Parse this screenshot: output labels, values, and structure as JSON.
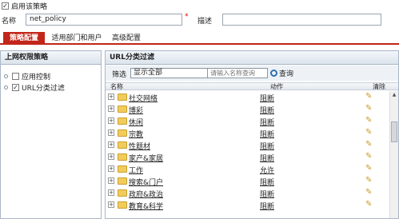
{
  "enable": {
    "label": "启用该策略",
    "checked": "✓"
  },
  "form": {
    "name_label": "名称",
    "name_value": "net_policy",
    "required_mark": "*",
    "desc_label": "描述"
  },
  "tabs": [
    {
      "label": "策略配置"
    },
    {
      "label": "适用部门和用户"
    },
    {
      "label": "高级配置"
    }
  ],
  "left_panel": {
    "title": "上网权限策略",
    "items": [
      {
        "label": "应用控制",
        "checked": ""
      },
      {
        "label": "URL分类过滤",
        "checked": "✓"
      }
    ]
  },
  "right_panel": {
    "title": "URL分类过滤",
    "filter_label": "筛选",
    "filter_value": "显示全部",
    "search_placeholder": "请输入名称查询",
    "search_button": "查询",
    "columns": {
      "name": "名称",
      "action": "动作",
      "clear": "清除"
    },
    "rows": [
      {
        "name": "社交网络",
        "action": "阻断"
      },
      {
        "name": "博彩",
        "action": "阻断"
      },
      {
        "name": "休闲",
        "action": "阻断"
      },
      {
        "name": "宗教",
        "action": "阻断"
      },
      {
        "name": "性题材",
        "action": "阻断"
      },
      {
        "name": "家产&家居",
        "action": "阻断"
      },
      {
        "name": "工作",
        "action": "允许"
      },
      {
        "name": "搜索&门户",
        "action": "阻断"
      },
      {
        "name": "政府&政治",
        "action": "阻断"
      },
      {
        "name": "教育&科学",
        "action": "阻断"
      }
    ]
  },
  "colors": {
    "tab_active": "#c2261a",
    "border": "#aab7c6",
    "folder": "#f2cc5a"
  }
}
